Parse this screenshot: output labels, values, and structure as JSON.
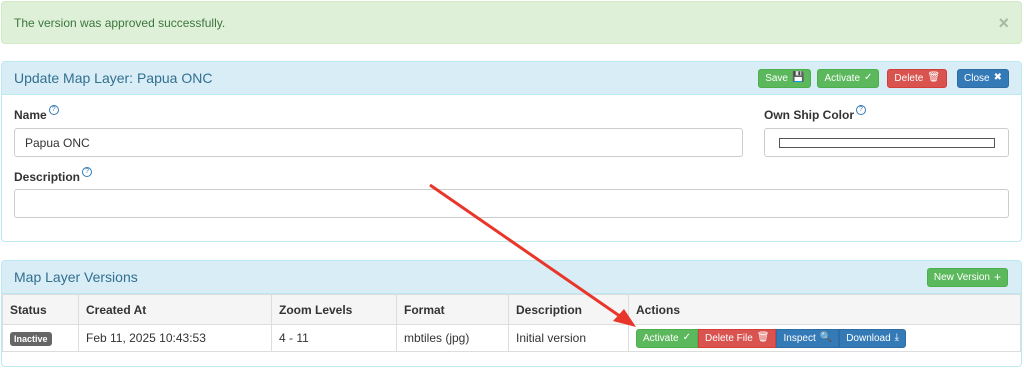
{
  "alert": {
    "message": "The version was approved successfully.",
    "close": "×"
  },
  "update_panel": {
    "title": "Update Map Layer: Papua ONC",
    "buttons": {
      "save": "Save",
      "activate": "Activate",
      "delete": "Delete",
      "close": "Close"
    },
    "name_label": "Name",
    "name_value": "Papua ONC",
    "own_ship_color_label": "Own Ship Color",
    "description_label": "Description",
    "description_value": ""
  },
  "versions_panel": {
    "title": "Map Layer Versions",
    "new_version": "New Version",
    "columns": [
      "Status",
      "Created At",
      "Zoom Levels",
      "Format",
      "Description",
      "Actions"
    ],
    "rows": [
      {
        "status": "Inactive",
        "created_at": "Feb 11, 2025 10:43:53",
        "zoom_levels": "4 - 11",
        "format": "mbtiles (jpg)",
        "description": "Initial version",
        "actions": {
          "activate": "Activate",
          "delete_file": "Delete File",
          "inspect": "Inspect",
          "download": "Download"
        }
      }
    ]
  },
  "colors": {
    "success": "#5cb85c",
    "danger": "#d9534f",
    "primary": "#337ab7",
    "panel_heading": "#d9edf7",
    "alert_bg": "#dff0d8",
    "annotation_arrow": "#e8372a"
  }
}
